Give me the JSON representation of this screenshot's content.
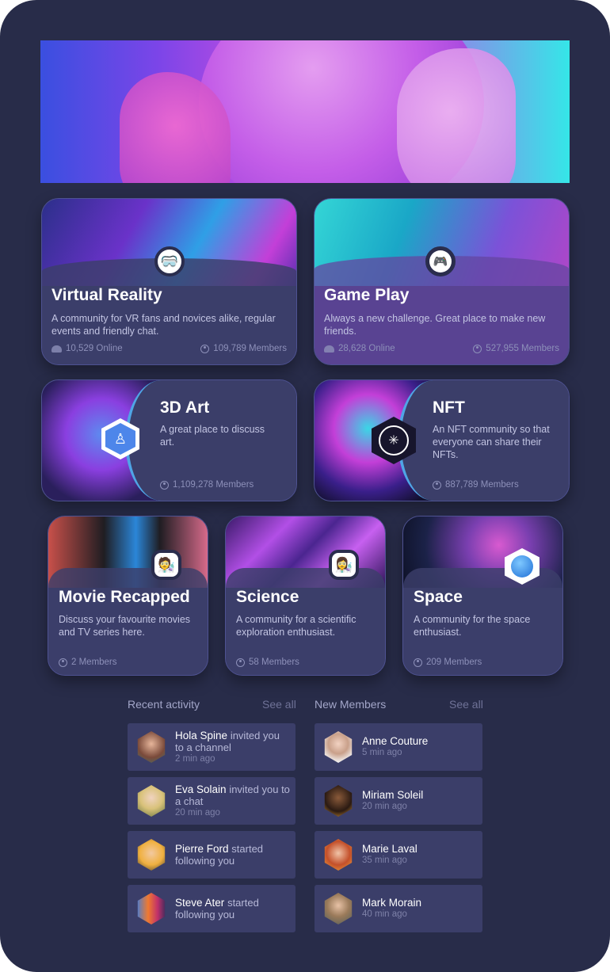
{
  "communities": [
    {
      "title": "Virtual Reality",
      "description": "A community for VR  fans and novices alike, regular events and friendly chat.",
      "online": "10,529 Online",
      "members": "109,789 Members",
      "badge_icon": "vr-headset-icon"
    },
    {
      "title": "Game Play",
      "description": "Always a new challenge. Great place to make new friends.",
      "online": "28,628 Online",
      "members": "527,955 Members",
      "badge_icon": "gamepad-icon"
    },
    {
      "title": "3D Art",
      "description": "A great place to discuss art.",
      "members": "1,109,278 Members",
      "badge_icon": "figure-icon"
    },
    {
      "title": "NFT",
      "description": "An NFT community so that everyone can share their NFTs.",
      "members": "887,789 Members",
      "badge_icon": "vitruvian-icon"
    },
    {
      "title": "Movie Recapped",
      "description": "Discuss your favourite movies and TV series here.",
      "members": "2 Members",
      "badge_icon": "movie-icon"
    },
    {
      "title": "Science",
      "description": "A community for a scientific exploration enthusiast.",
      "members": "58 Members",
      "badge_icon": "science-icon"
    },
    {
      "title": "Space",
      "description": "A community for the space enthusiast.",
      "members": "209 Members",
      "badge_icon": "planet-icon"
    }
  ],
  "recent_activity": {
    "title": "Recent activity",
    "see_all": "See all",
    "items": [
      {
        "name": "Hola Spine",
        "action": "invited you to a channel",
        "time": "2 min ago"
      },
      {
        "name": "Eva Solain",
        "action": "invited you to a chat",
        "time": "20 min ago"
      },
      {
        "name": "Pierre Ford",
        "action": "started following you",
        "time": ""
      },
      {
        "name": "Steve Ater",
        "action": "started following you",
        "time": ""
      }
    ]
  },
  "new_members": {
    "title": "New Members",
    "see_all": "See all",
    "items": [
      {
        "name": "Anne Couture",
        "time": "5 min ago"
      },
      {
        "name": "Miriam Soleil",
        "time": "20 min ago"
      },
      {
        "name": "Marie Laval",
        "time": "35 min ago"
      },
      {
        "name": "Mark  Morain",
        "time": "40 min ago"
      }
    ]
  },
  "colors": {
    "background": "#282c49",
    "card": "#3b3e69",
    "accent_cyan": "#35e6e8",
    "accent_pink": "#c94ee0"
  }
}
